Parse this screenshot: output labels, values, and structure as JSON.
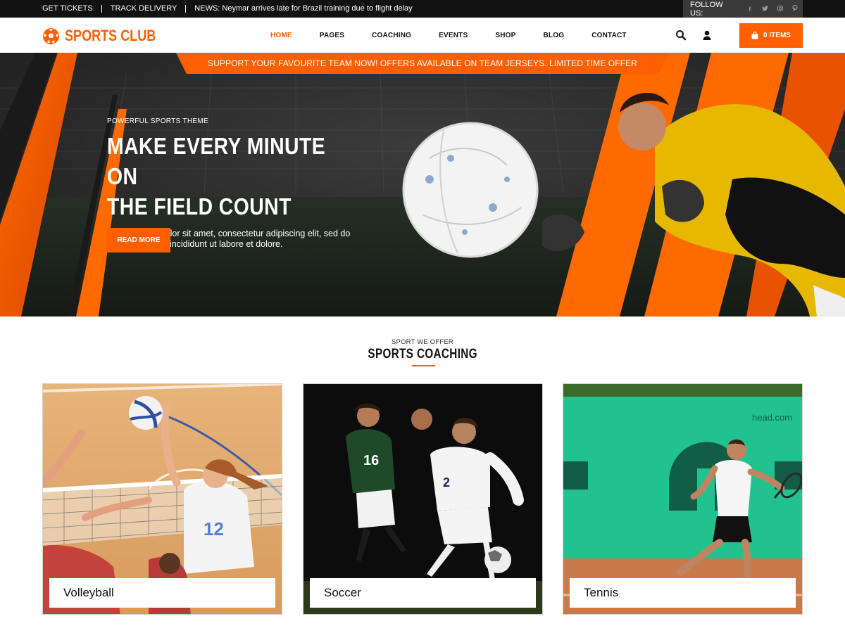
{
  "topbar": {
    "links": [
      "GET TICKETS",
      "TRACK DELIVERY",
      "NEWS: Neymar arrives late for Brazil training due to flight delay"
    ],
    "follow_label": "FOLLOW US:",
    "social_icons": [
      "facebook-icon",
      "twitter-icon",
      "instagram-icon",
      "pinterest-icon"
    ]
  },
  "header": {
    "logo_text": "SPORTS CLUB",
    "nav": [
      {
        "label": "HOME",
        "active": true
      },
      {
        "label": "PAGES",
        "active": false
      },
      {
        "label": "COACHING",
        "active": false
      },
      {
        "label": "EVENTS",
        "active": false
      },
      {
        "label": "SHOP",
        "active": false
      },
      {
        "label": "BLOG",
        "active": false
      },
      {
        "label": "CONTACT",
        "active": false
      }
    ],
    "icons": [
      "search-icon",
      "user-icon"
    ],
    "cart_label": "0 ITEMS"
  },
  "hero": {
    "promo": "SUPPORT YOUR FAVOURITE TEAM NOW! OFFERS AVAILABLE ON TEAM JERSEYS. LIMITED TIME OFFER",
    "kicker": "POWERFUL SPORTS THEME",
    "title_line1": "MAKE EVERY MINUTE ON",
    "title_line2": "THE FIELD COUNT",
    "description": "Lorem ipsum dolor sit amet, consectetur adipiscing elit, sed do euismod tempo incididunt ut labore et dolore.",
    "button": "READ MORE"
  },
  "coaching": {
    "kicker": "SPORT WE OFFER",
    "title": "SPORTS COACHING",
    "cards": [
      {
        "label": "Volleyball"
      },
      {
        "label": "Soccer"
      },
      {
        "label": "Tennis",
        "sign": "head.com"
      }
    ]
  },
  "colors": {
    "accent": "#ff5f00",
    "topbar": "#111111",
    "follow_bg": "#3a3a3a"
  }
}
